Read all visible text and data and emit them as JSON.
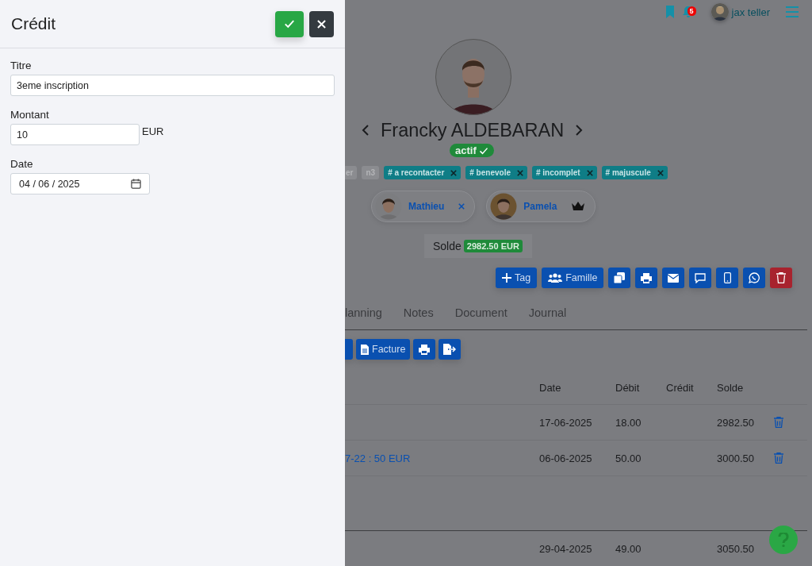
{
  "panel": {
    "title": "Crédit",
    "fields": [
      {
        "kind": "text",
        "label": "Titre",
        "value": "3eme inscription"
      },
      {
        "kind": "amount",
        "label": "Montant",
        "value": "10",
        "unit": "EUR"
      },
      {
        "kind": "date",
        "label": "Date",
        "value": "04 / 06 / 2025"
      }
    ]
  },
  "navbar": {
    "notification_count": "5",
    "user_name": "jax teller"
  },
  "profile": {
    "name": "Francky ALDEBARAN",
    "status": "actif"
  },
  "tags": [
    {
      "kind": "plain",
      "label": "er"
    },
    {
      "kind": "plain",
      "label": "n3"
    },
    {
      "kind": "removable",
      "label": "# a recontacter"
    },
    {
      "kind": "removable",
      "label": "# benevole"
    },
    {
      "kind": "removable",
      "label": "# incomplet"
    },
    {
      "kind": "removable",
      "label": "# majuscule"
    }
  ],
  "family": [
    {
      "kind": "removable",
      "name": "Mathieu"
    },
    {
      "kind": "head",
      "name": "Pamela"
    }
  ],
  "balance": {
    "label": "Solde",
    "value": "2982.50 EUR"
  },
  "actions": [
    {
      "kind": "tag",
      "label": "Tag"
    },
    {
      "kind": "family",
      "label": "Famille"
    },
    {
      "kind": "duplicate"
    },
    {
      "kind": "print"
    },
    {
      "kind": "mail"
    },
    {
      "kind": "message"
    },
    {
      "kind": "phone"
    },
    {
      "kind": "whatsapp"
    },
    {
      "kind": "delete"
    }
  ],
  "tabs": [
    {
      "label": "lanning",
      "selected": false
    },
    {
      "label": "Notes",
      "selected": false
    },
    {
      "label": "Document",
      "selected": false
    },
    {
      "label": "Journal",
      "selected": false
    }
  ],
  "toolbar": [
    {
      "kind": "cut"
    },
    {
      "kind": "invoice",
      "label": "Facture"
    },
    {
      "kind": "print"
    },
    {
      "kind": "export"
    }
  ],
  "table": {
    "columns": [
      "Date",
      "Débit",
      "Crédit",
      "Solde"
    ],
    "rows": [
      {
        "kind": "entry",
        "date": "17-06-2025",
        "debit": "18.00",
        "balance": "2982.50",
        "deletable": true
      },
      {
        "kind": "entry",
        "link": "7-22 : 50 EUR",
        "date": "06-06-2025",
        "debit": "50.00",
        "balance": "3000.50",
        "deletable": true
      },
      {
        "kind": "separated",
        "date": "29-04-2025",
        "debit": "49.00",
        "balance": "3050.50",
        "deletable": false
      }
    ]
  }
}
